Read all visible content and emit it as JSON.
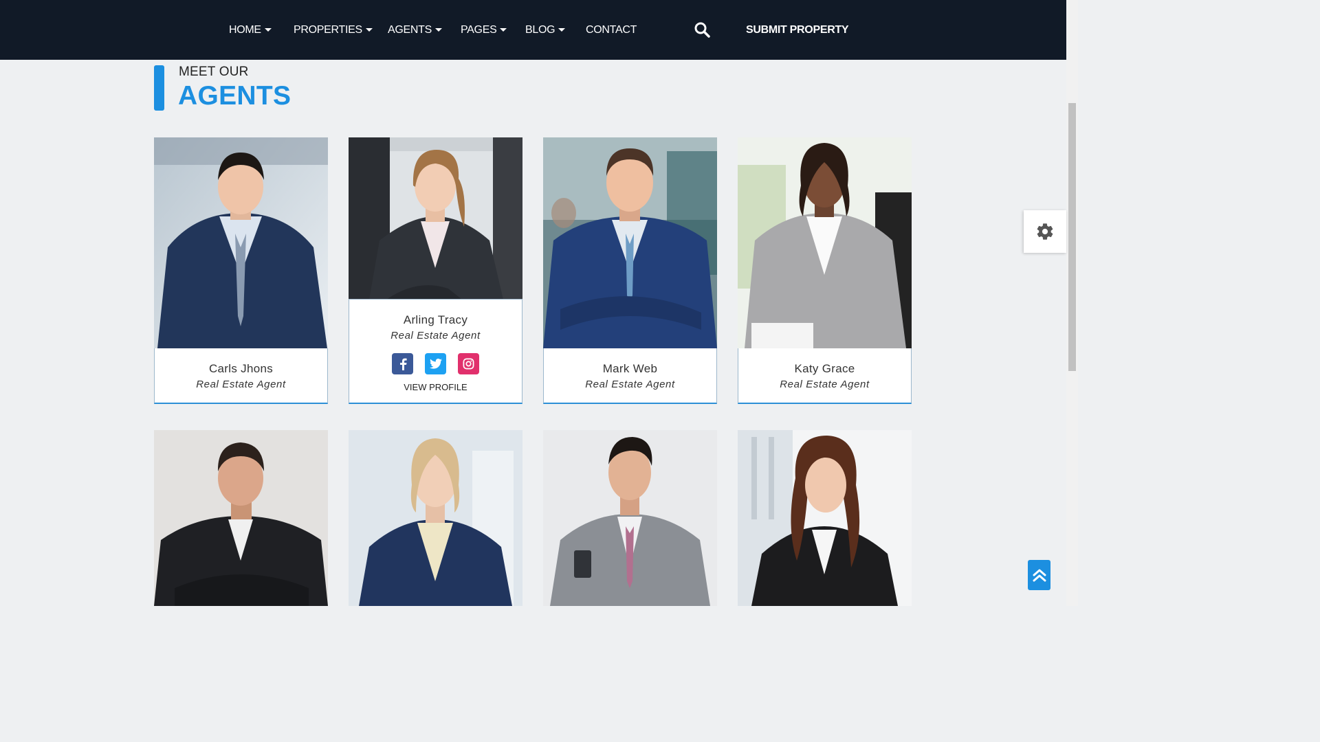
{
  "nav": {
    "items": [
      {
        "label": "HOME",
        "has_dropdown": true
      },
      {
        "label": "PROPERTIES",
        "has_dropdown": true
      },
      {
        "label": "AGENTS",
        "has_dropdown": true
      },
      {
        "label": "PAGES",
        "has_dropdown": true
      },
      {
        "label": "BLOG",
        "has_dropdown": true
      },
      {
        "label": "CONTACT",
        "has_dropdown": false
      }
    ],
    "search_icon": "search-icon",
    "submit_label": "SUBMIT PROPERTY"
  },
  "section": {
    "subtitle": "MEET OUR",
    "title": "AGENTS"
  },
  "agents": [
    {
      "name": "Carls Jhons",
      "role": "Real Estate Agent"
    },
    {
      "name": "Arling Tracy",
      "role": "Real Estate Agent",
      "view_profile": "VIEW PROFILE",
      "socials": [
        "facebook-icon",
        "twitter-icon",
        "instagram-icon"
      ]
    },
    {
      "name": "Mark Web",
      "role": "Real Estate Agent"
    },
    {
      "name": "Katy Grace",
      "role": "Real Estate Agent"
    }
  ],
  "colors": {
    "nav_bg": "#111a27",
    "accent": "#1c8fe0",
    "page_bg": "#eef0f2"
  },
  "widgets": {
    "settings_icon": "gear-icon",
    "scroll_top_icon": "double-chevron-up-icon"
  }
}
